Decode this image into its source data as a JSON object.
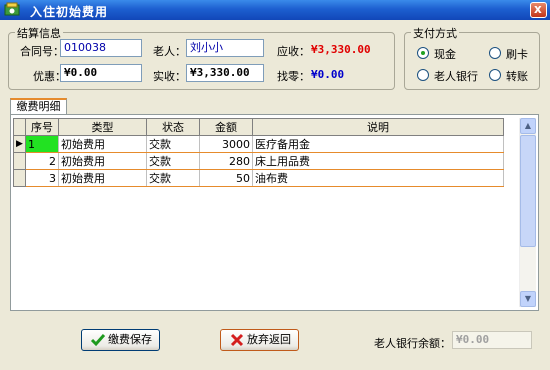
{
  "window": {
    "title": "入住初始费用",
    "close_glyph": "x"
  },
  "settlement": {
    "group_title": "结算信息",
    "contract_label": "合同号：",
    "contract_value": "010038",
    "elder_label": "老人：",
    "elder_value": "刘小小",
    "receivable_label": "应收：",
    "receivable_value": "¥3,330.00",
    "discount_label": "优惠：",
    "discount_value": "¥0.00",
    "received_label": "实收：",
    "received_value": "¥3,330.00",
    "change_label": "找零：",
    "change_value": "¥0.00"
  },
  "payment": {
    "group_title": "支付方式",
    "options": [
      {
        "label": "现金",
        "checked": true
      },
      {
        "label": "刷卡",
        "checked": false
      },
      {
        "label": "老人银行",
        "checked": false
      },
      {
        "label": "转账",
        "checked": false
      }
    ]
  },
  "details": {
    "tab_label": "缴费明细",
    "columns": [
      "序号",
      "类型",
      "状态",
      "金额",
      "说明"
    ],
    "rows": [
      {
        "index": "1",
        "type": "初始费用",
        "status": "交款",
        "amount": "3000",
        "note": "医疗备用金"
      },
      {
        "index": "2",
        "type": "初始费用",
        "status": "交款",
        "amount": "280",
        "note": "床上用品费"
      },
      {
        "index": "3",
        "type": "初始费用",
        "status": "交款",
        "amount": "50",
        "note": "油布费"
      }
    ],
    "current_row_indicator": "▶"
  },
  "footer": {
    "save_label": "缴费保存",
    "cancel_label": "放弃返回",
    "balance_label": "老人银行余额：",
    "balance_value": "¥0.00"
  },
  "icons": {
    "app": "app-icon",
    "save": "checkmark-icon",
    "cancel": "red-x-icon"
  },
  "colors": {
    "titlebar": "#1D5FD0",
    "receivable": "#E00000",
    "change": "#0000CC",
    "current_cell": "#22E222",
    "row_rule": "#E68B2C"
  }
}
